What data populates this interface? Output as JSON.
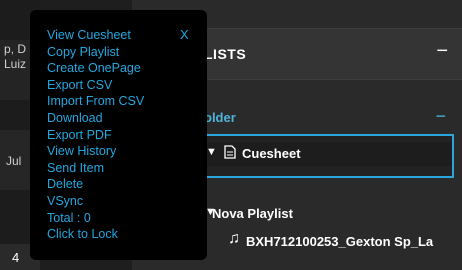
{
  "left_cards": [
    {
      "lines": [
        "p, D",
        "Luiz"
      ]
    },
    {
      "lines": [
        "Jul"
      ]
    }
  ],
  "playlists": {
    "header_title": "LISTS",
    "collapse_symbol": "−",
    "folder_label": "older",
    "folder_collapse_symbol": "−",
    "cuesheet_label": "Cuesheet",
    "nova_label": "Nova Playlist",
    "track_label": "BXH712100253_Gexton Sp_La"
  },
  "pager": {
    "current": "4"
  },
  "context_menu": {
    "close_label": "X",
    "items": [
      "View Cuesheet",
      "Copy Playlist",
      "Create OnePage",
      "Export CSV",
      "Import From CSV",
      "Download",
      "Export PDF",
      "View History",
      "Send Item",
      "Delete",
      "VSync",
      "Total : 0",
      "Click to Lock"
    ]
  }
}
